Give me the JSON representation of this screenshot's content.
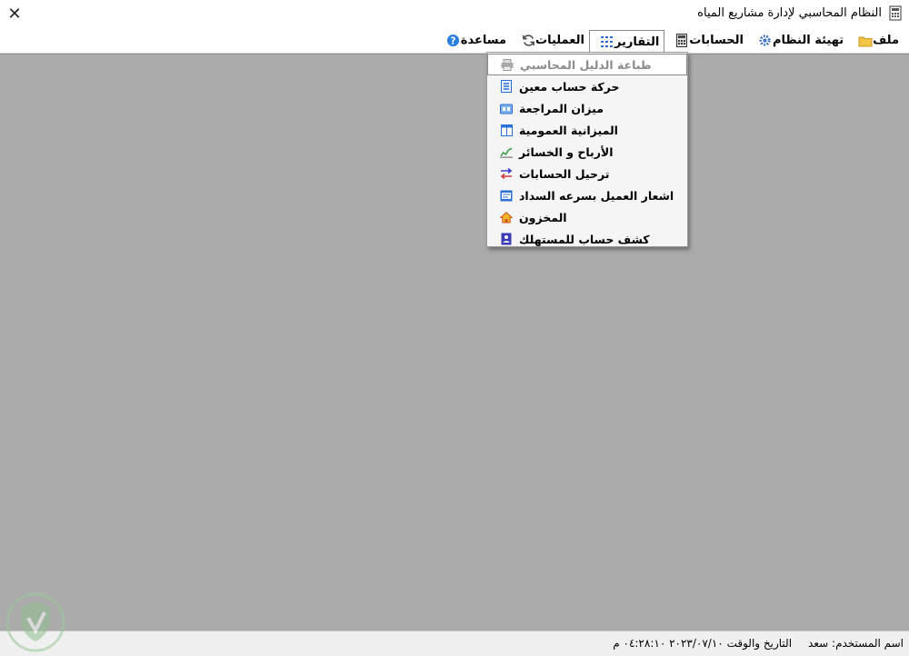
{
  "window": {
    "title": "النظام المحاسبي لإدارة مشاريع المياه",
    "close_glyph": "✕"
  },
  "menubar": {
    "items": [
      {
        "label": "ملف",
        "icon": "folder-icon"
      },
      {
        "label": "تهيئة النظام",
        "icon": "gear-icon"
      },
      {
        "label": "الحسابات",
        "icon": "calculator-icon"
      },
      {
        "label": "التقارير",
        "icon": "report-grid-icon",
        "active": true
      },
      {
        "label": "العمليات",
        "icon": "refresh-icon"
      },
      {
        "label": "مساعدة",
        "icon": "help-icon"
      }
    ]
  },
  "reports_menu": {
    "items": [
      {
        "label": "طباعة الدليل المحاسبي",
        "icon": "printer-icon",
        "disabled": true,
        "hover": true
      },
      {
        "label": "حركة حساب معين",
        "icon": "ledger-icon"
      },
      {
        "label": "ميزان المراجعة",
        "icon": "balance-icon"
      },
      {
        "label": "الميزانية العمومية",
        "icon": "sheet-icon"
      },
      {
        "label": "الأرباح و الخسائر",
        "icon": "chart-icon"
      },
      {
        "label": "ترحيل الحسابات",
        "icon": "transfer-arrows-icon"
      },
      {
        "label": "اشعار العميل بسرعه السداد",
        "icon": "notice-icon"
      },
      {
        "label": "المخزون",
        "icon": "home-icon"
      },
      {
        "label": "كشف حساب للمستهلك",
        "icon": "consumer-icon"
      }
    ]
  },
  "statusbar": {
    "user_label": "اسم المستخدم:",
    "user_name": "سعد",
    "datetime_label": "التاريخ والوقت",
    "datetime_value": "٢٠٢٣/٠٧/١٠ ٠٤:٢٨:١٠ م"
  },
  "colors": {
    "client_bg": "#ababab",
    "accent_blue": "#2b6fd6"
  }
}
